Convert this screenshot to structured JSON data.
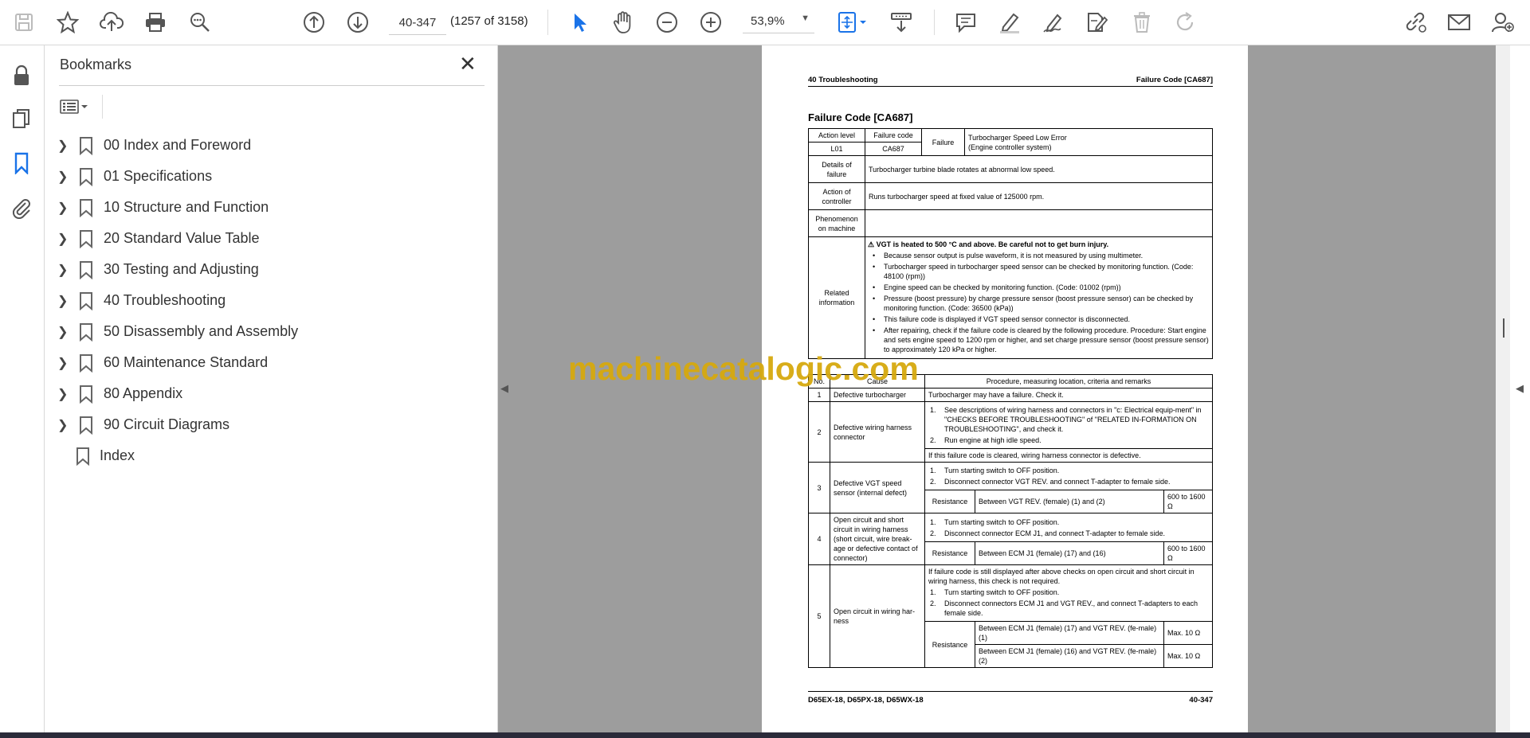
{
  "toolbar": {
    "page_input": "40-347",
    "page_count": "(1257 of 3158)",
    "zoom": "53,9%"
  },
  "bookmarks": {
    "title": "Bookmarks",
    "items": [
      {
        "label": "00 Index and Foreword"
      },
      {
        "label": "01 Specifications"
      },
      {
        "label": "10 Structure and Function"
      },
      {
        "label": "20 Standard Value Table"
      },
      {
        "label": "30 Testing and Adjusting"
      },
      {
        "label": "40 Troubleshooting"
      },
      {
        "label": "50 Disassembly and Assembly"
      },
      {
        "label": "60 Maintenance Standard"
      },
      {
        "label": "80 Appendix"
      },
      {
        "label": "90 Circuit Diagrams"
      },
      {
        "label": "Index"
      }
    ]
  },
  "page": {
    "header_left": "40 Troubleshooting",
    "header_right": "Failure Code [CA687]",
    "title": "Failure Code [CA687]",
    "action_level_h": "Action level",
    "failure_code_h": "Failure code",
    "action_level": "L01",
    "failure_code": "CA687",
    "failure_h": "Failure",
    "failure_1": "Turbocharger Speed Low Error",
    "failure_2": "(Engine controller system)",
    "details_h": "Details of failure",
    "details": "Turbocharger turbine blade rotates at abnormal low speed.",
    "action_h": "Action of controller",
    "action": "Runs turbocharger speed at fixed value of 125000 rpm.",
    "phenomenon_h": "Phenomenon on machine",
    "related_h": "Related information",
    "warning": "VGT is heated to 500 °C and above. Be careful not to get burn injury.",
    "related": [
      "Because sensor output is pulse waveform, it is not measured by using multimeter.",
      "Turbocharger speed in turbocharger speed sensor can be checked by monitoring function. (Code: 48100 (rpm))",
      "Engine speed can be checked by monitoring function. (Code: 01002 (rpm))",
      "Pressure (boost pressure) by charge pressure sensor (boost pressure sensor) can be checked by monitoring function. (Code: 36500 (kPa))",
      "This failure code is displayed if VGT speed sensor connector is disconnected.",
      "After repairing, check if the failure code is cleared by the following procedure. Procedure: Start engine and sets engine speed to 1200 rpm or higher, and set charge pressure sensor (boost pressure sensor) to approximately 120 kPa or higher."
    ],
    "no_h": "No.",
    "cause_h": "Cause",
    "proc_h": "Procedure, measuring location, criteria and remarks",
    "c1_no": "1",
    "c1_cause": "Defective turbocharger",
    "c1_proc": "Turbocharger may have a failure. Check it.",
    "c2_no": "2",
    "c2_cause": "Defective wiring harness connector",
    "c2_s1": "See descriptions of wiring harness and connectors in \"c: Electrical equip-ment\" in \"CHECKS BEFORE TROUBLESHOOTING\" of \"RELATED IN-FORMATION ON TROUBLESHOOTING\", and check it.",
    "c2_s2": "Run engine at high idle speed.",
    "c2_note": "If this failure code is cleared, wiring harness connector is defective.",
    "c3_no": "3",
    "c3_cause": "Defective VGT speed sensor (internal defect)",
    "c3_s1": "Turn starting switch to OFF position.",
    "c3_s2": "Disconnect connector VGT REV. and connect T-adapter to female side.",
    "c3_res": "Resistance",
    "c3_loc": "Between VGT REV. (female) (1) and (2)",
    "c3_val": "600 to 1600 Ω",
    "c4_no": "4",
    "c4_cause": "Open circuit and short circuit in wiring harness (short circuit, wire break-age or defective contact of connector)",
    "c4_s1": "Turn starting switch to OFF position.",
    "c4_s2": "Disconnect connector ECM J1, and connect T-adapter to female side.",
    "c4_res": "Resistance",
    "c4_loc": "Between ECM J1 (female) (17) and (16)",
    "c4_val": "600 to 1600 Ω",
    "c5_no": "5",
    "c5_cause": "Open circuit in wiring har-ness",
    "c5_note": "If failure code is still displayed after above checks on open circuit and short circuit in wiring harness, this check is not required.",
    "c5_s1": "Turn starting switch to OFF position.",
    "c5_s2": "Disconnect connectors ECM J1 and VGT REV., and connect T-adapters to each female side.",
    "c5_res": "Resistance",
    "c5_loc1": "Between ECM J1 (female) (17) and VGT REV. (fe-male) (1)",
    "c5_val1": "Max. 10 Ω",
    "c5_loc2": "Between ECM J1 (female) (16) and VGT REV. (fe-male) (2)",
    "c5_val2": "Max. 10 Ω",
    "footer_left": "D65EX-18, D65PX-18, D65WX-18",
    "footer_right": "40-347",
    "n1": "1.",
    "n2": "2."
  },
  "watermark": "machinecatalogic.com"
}
